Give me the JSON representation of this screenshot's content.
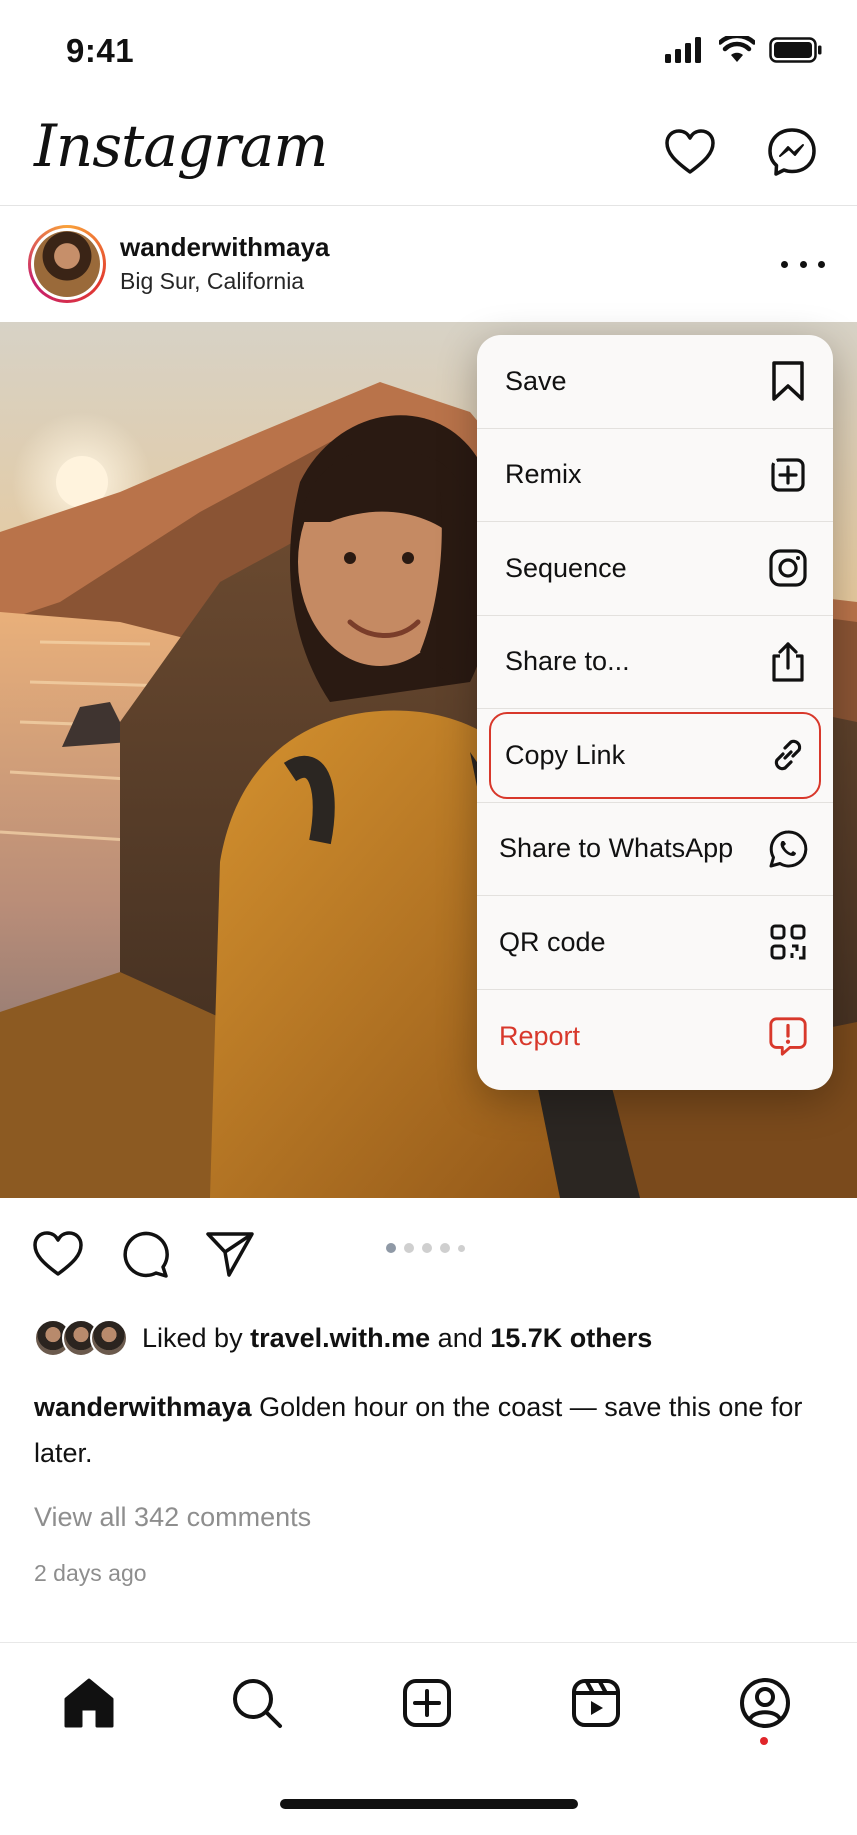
{
  "status_bar": {
    "time": "9:41"
  },
  "header": {
    "logo": "Instagram",
    "icons": [
      "heart-icon",
      "messenger-icon"
    ]
  },
  "post": {
    "username": "wanderwithmaya",
    "location": "Big Sur, California",
    "more_icon": "more-horizontal-icon"
  },
  "menu": {
    "items": [
      {
        "label": "Save",
        "icon": "bookmark-icon"
      },
      {
        "label": "Remix",
        "icon": "remix-icon"
      },
      {
        "label": "Sequence",
        "icon": "sequence-icon"
      },
      {
        "label": "Share to...",
        "icon": "share-icon"
      },
      {
        "label": "Copy Link",
        "icon": "link-icon",
        "highlighted": true
      },
      {
        "label": "Share to WhatsApp",
        "icon": "whatsapp-icon"
      },
      {
        "label": "QR code",
        "icon": "qr-code-icon"
      },
      {
        "label": "Report",
        "icon": "report-icon",
        "danger": true
      }
    ],
    "danger_color": "#d8382b"
  },
  "actions": {
    "icons": [
      "heart-icon",
      "comment-icon",
      "send-icon"
    ],
    "carousel_count": 5,
    "carousel_active_index": 0
  },
  "likes": {
    "prefix": "Liked by",
    "user": "travel.with.me",
    "conjunction": "and",
    "others": "15.7K others"
  },
  "caption": {
    "username": "wanderwithmaya",
    "text": "Golden hour on the coast — save this one for later."
  },
  "comments": {
    "link": "View all 342 comments"
  },
  "timestamp": "2 days ago",
  "tab_bar": {
    "tabs": [
      "home-icon",
      "search-icon",
      "create-icon",
      "reels-icon",
      "profile-icon"
    ],
    "active": "home",
    "notification_color": "#e0262a"
  }
}
